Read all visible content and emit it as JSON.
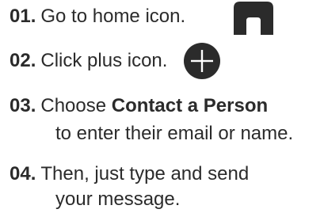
{
  "steps": [
    {
      "number": "01.",
      "text": "Go to home icon.",
      "icon": "home-icon"
    },
    {
      "number": "02.",
      "text": "Click plus icon.",
      "icon": "plus-icon"
    },
    {
      "number": "03.",
      "text_before": "Choose ",
      "text_bold": "Contact a Person",
      "text_line2": "to enter their email or name."
    },
    {
      "number": "04.",
      "text": "Then, just type and send",
      "text_line2": "your message."
    }
  ],
  "colors": {
    "text": "#2b2b2b",
    "icon_fill": "#2b2b2b"
  }
}
